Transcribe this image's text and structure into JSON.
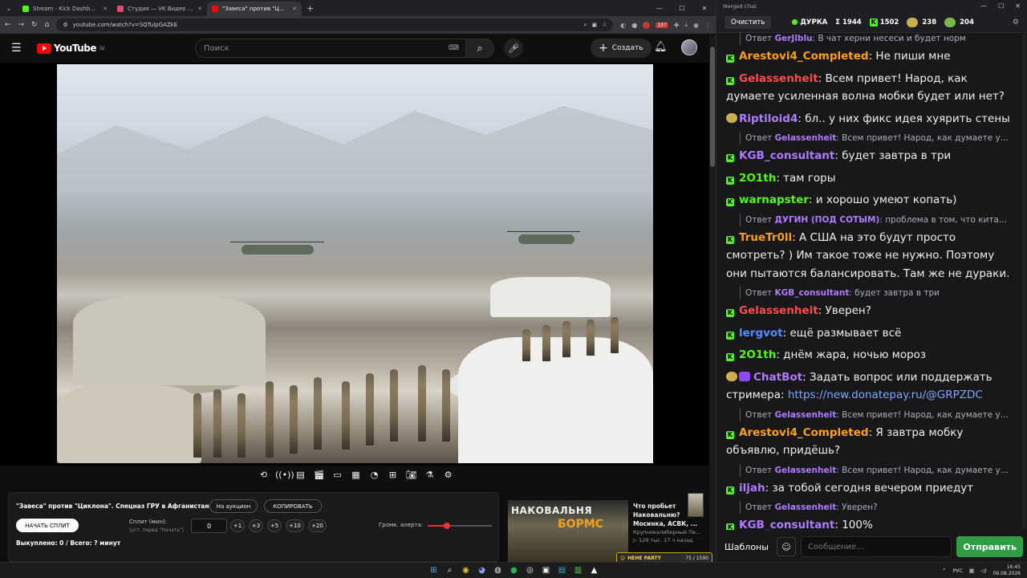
{
  "browser": {
    "tabs": [
      {
        "label": "Stream - Kick Dashboard",
        "color": "#53fc18"
      },
      {
        "label": "Студия — VK Видео Live",
        "color": "#e34a6f"
      },
      {
        "label": "\"Завеса\" против \"Циклона\". С",
        "color": "#ff0000"
      }
    ],
    "new_tab": "+",
    "url": "youtube.com/watch?v=SQTulpGAZkE",
    "ext_badge": "337"
  },
  "youtube": {
    "logo": "YouTube",
    "region": "LV",
    "search_placeholder": "Поиск",
    "create_label": "Создать"
  },
  "panel": {
    "title": "\"Завеса\" против \"Циклона\". Спецназ ГРУ в Афганистане.",
    "auction_label": "На аукцион",
    "copy_label": "КОПИРОВАТЬ",
    "start_split_label": "НАЧАТЬ СПЛИТ",
    "split_label": "Сплит (мин):",
    "split_sub": "(уст. перед \"Начать\")",
    "split_value": "0",
    "increments": [
      "+1",
      "+3",
      "+5",
      "+10",
      "+20"
    ],
    "alert_volume_label": "Громк. алерта:",
    "alert_volume": 0.3,
    "bought_text": "Выкуплено: 0 / Всего: ? минут"
  },
  "recommendation": {
    "thumb_text1": "НАКОВАЛЬНЯ",
    "thumb_text2": "БОРМС",
    "title": "Что пробьет Наковальню? Мосинка, АСВК, ...",
    "channel": "Крупнокалиберный Пе...",
    "stats": "▷ 129 тыс.  17 ч назад"
  },
  "hehe_party": {
    "label": "HEHE PARTY",
    "count": "75 / 1590"
  },
  "chat": {
    "window_title": "Merged Chat",
    "clear_label": "Очистить",
    "streamer": "ДУРКА",
    "sigma": "Σ 1944",
    "kick_count": "1502",
    "stat3": "238",
    "stat4": "204",
    "messages": [
      {
        "type": "reply",
        "prefix": "Ответ",
        "name": "GerJlblu",
        "text": ": В чат херни несеси и будет норм"
      },
      {
        "type": "msg",
        "platform": "kick",
        "user": "Arestovi4_Completed",
        "color": "#ff9f1a",
        "text": ": Не пиши мне"
      },
      {
        "type": "msg",
        "platform": "kick",
        "user": "Gelassenheit",
        "color": "#ff4d4d",
        "text": ": Всем привет! Народ, как думаете усиленная волна мобки   будет  или нет?"
      },
      {
        "type": "msg",
        "platform": "emote",
        "user": "Riptiloid4",
        "color": "#b07dff",
        "text": ": бл.. у них фикс идея хуярить стены"
      },
      {
        "type": "reply",
        "prefix": "Ответ",
        "name": "Gelassenheit",
        "text": ": Всем привет! Народ, как думаете у..."
      },
      {
        "type": "msg",
        "platform": "kick",
        "user": "KGB_consultant",
        "color": "#b07dff",
        "text": ": будет завтра в три"
      },
      {
        "type": "msg",
        "platform": "kick",
        "user": "2O1th",
        "color": "#53fc18",
        "text": ": там горы"
      },
      {
        "type": "msg",
        "platform": "kick",
        "user": "warnapster",
        "color": "#53fc18",
        "text": ": и хорошо умеют копать)"
      },
      {
        "type": "reply",
        "prefix": "Ответ",
        "name": "ДУГИН (ПОД СОТЫМ)",
        "text": ": проблема в том, что кита..."
      },
      {
        "type": "msg",
        "platform": "kick",
        "user": "TrueTr0ll",
        "color": "#ff9f1a",
        "text": ": А США на это будут просто смотреть? ) Им такое тоже не нужно. Поэтому они пытаются балансировать. Там же не дураки."
      },
      {
        "type": "reply",
        "prefix": "Ответ",
        "name": "KGB_consultant",
        "text": ": будет завтра в три"
      },
      {
        "type": "msg",
        "platform": "kick",
        "user": "Gelassenheit",
        "color": "#ff4d4d",
        "text": ": Уверен?"
      },
      {
        "type": "msg",
        "platform": "kick",
        "user": "lergvot",
        "color": "#5b8cff",
        "text": ": ещё размывает всё"
      },
      {
        "type": "msg",
        "platform": "kick",
        "user": "2O1th",
        "color": "#53fc18",
        "text": ": днём жара, ночью мороз"
      },
      {
        "type": "msg",
        "platform": "bot",
        "user": "ChatBot",
        "color": "#b07dff",
        "text": ": Задать вопрос или поддержать стримера: ",
        "link": "https://new.donatepay.ru/@GRPZDC"
      },
      {
        "type": "reply",
        "prefix": "Ответ",
        "name": "Gelassenheit",
        "text": ": Всем привет! Народ, как думаете у..."
      },
      {
        "type": "msg",
        "platform": "kick",
        "user": "Arestovi4_Completed",
        "color": "#ff9f1a",
        "text": ": Я завтра мобку объявлю, придёшь?"
      },
      {
        "type": "reply",
        "prefix": "Ответ",
        "name": "Gelassenheit",
        "text": ": Всем привет! Народ, как думаете у..."
      },
      {
        "type": "msg",
        "platform": "kick",
        "user": "iljah",
        "color": "#b07dff",
        "text": ": за тобой сегодня вечером приедут"
      },
      {
        "type": "reply",
        "prefix": "Ответ",
        "name": "Gelassenheit",
        "text": ": Уверен?"
      },
      {
        "type": "msg",
        "platform": "kick",
        "user": "KGB_consultant",
        "color": "#b07dff",
        "text": ": 100%"
      }
    ],
    "templates_label": "Шаблоны",
    "input_placeholder": "Сообщение...",
    "send_label": "Отправить"
  },
  "taskbar": {
    "lang": "РУС",
    "time": "16:45",
    "date": "06.08.2026"
  }
}
